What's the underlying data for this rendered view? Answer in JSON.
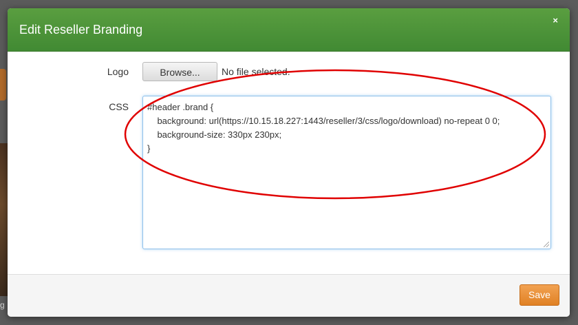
{
  "modal": {
    "title": "Edit Reseller Branding",
    "close_glyph": "×"
  },
  "form": {
    "logo_label": "Logo",
    "browse_label": "Browse...",
    "file_status": "No file selected.",
    "css_label": "CSS",
    "css_value": "#header .brand {\n    background: url(https://10.15.18.227:1443/reseller/3/css/logo/download) no-repeat 0 0;\n    background-size: 330px 230px;\n}"
  },
  "footer": {
    "save_label": "Save"
  },
  "background": {
    "partial_text": "g"
  },
  "colors": {
    "header_green": "#4a9339",
    "save_orange": "#e88a2e",
    "annotation_red": "#e00000"
  }
}
